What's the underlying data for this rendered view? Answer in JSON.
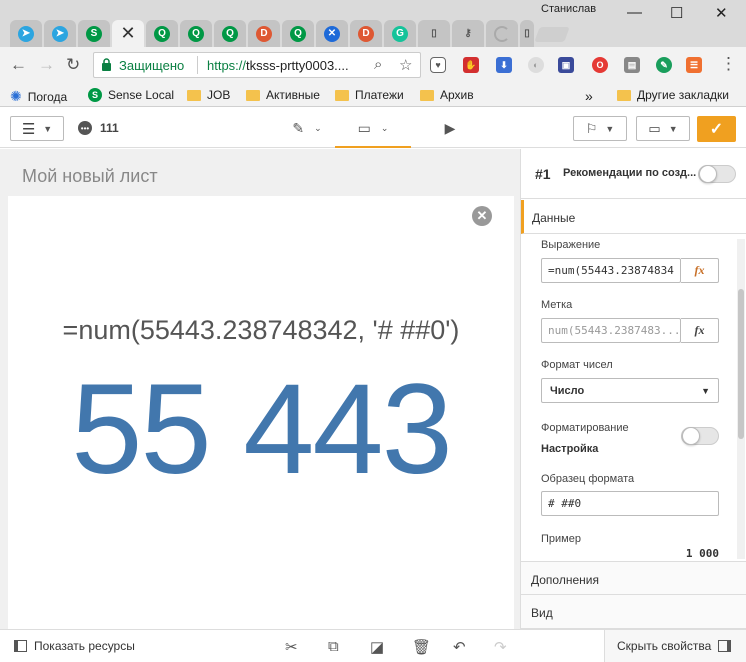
{
  "browser": {
    "profile_name": "Станислав",
    "tabs": [
      {
        "icon": "telegram-icon",
        "color": "#2ca5e0"
      },
      {
        "icon": "telegram-icon",
        "color": "#2ca5e0"
      },
      {
        "icon": "sense-icon",
        "color": "#009845"
      },
      {
        "icon": "close-icon",
        "active": true
      },
      {
        "icon": "qlik-icon",
        "color": "#009845"
      },
      {
        "icon": "qlik-icon",
        "color": "#009845"
      },
      {
        "icon": "qlik-icon",
        "color": "#009845"
      },
      {
        "icon": "duckduckgo-icon",
        "color": "#de5833"
      },
      {
        "icon": "qlik-icon",
        "color": "#009845"
      },
      {
        "icon": "confluence-icon",
        "color": "#1e6ad8"
      },
      {
        "icon": "duckduckgo-icon",
        "color": "#de5833"
      },
      {
        "icon": "grammarly-icon",
        "color": "#15c39a"
      },
      {
        "icon": "document-icon",
        "color": "#777777"
      },
      {
        "icon": "key-icon",
        "color": "#555555"
      },
      {
        "icon": "loading-icon",
        "color": "#999999"
      },
      {
        "icon": "document-icon",
        "color": "#777777"
      }
    ],
    "secure_label": "Защищено",
    "url_scheme": "https://",
    "url_rest": "tksss-prtty0003....",
    "bookmarks": [
      {
        "label": "Погода",
        "icon": "weather-icon"
      },
      {
        "label": "Sense Local",
        "icon": "sense-icon"
      },
      {
        "label": "JOB",
        "icon": "folder-icon"
      },
      {
        "label": "Активные",
        "icon": "folder-icon"
      },
      {
        "label": "Платежи",
        "icon": "folder-icon"
      },
      {
        "label": "Архив",
        "icon": "folder-icon"
      }
    ],
    "more_bookmarks": "»",
    "other_bookmarks": "Другие закладки"
  },
  "toolbar": {
    "comments_count": "111"
  },
  "sheet": {
    "title": "Мой новый лист",
    "kpi_title": "=num(55443.238748342, '# ##0')",
    "kpi_value": "55 443"
  },
  "panel": {
    "item_number": "#1",
    "item_name": "Рекомендации по созд...",
    "tab_data": "Данные",
    "expression_label": "Выражение",
    "expression_value": "=num(55443.23874834",
    "label_label": "Метка",
    "label_placeholder": "num(55443.2387483...",
    "fx_label": "fx",
    "number_format_label": "Формат чисел",
    "number_format_value": "Число",
    "formatting_label": "Форматирование",
    "formatting_value": "Настройка",
    "format_pattern_label": "Образец формата",
    "format_pattern_value": "# ##0",
    "example_label": "Пример",
    "example_value": "1 000",
    "tab_addons": "Дополнения",
    "tab_view": "Вид"
  },
  "bottombar": {
    "show_assets": "Показать ресурсы",
    "hide_properties": "Скрыть свойства"
  },
  "colors": {
    "accent": "#f0a020",
    "kpi_value": "#4277ad",
    "secure_green": "#0b8043"
  }
}
